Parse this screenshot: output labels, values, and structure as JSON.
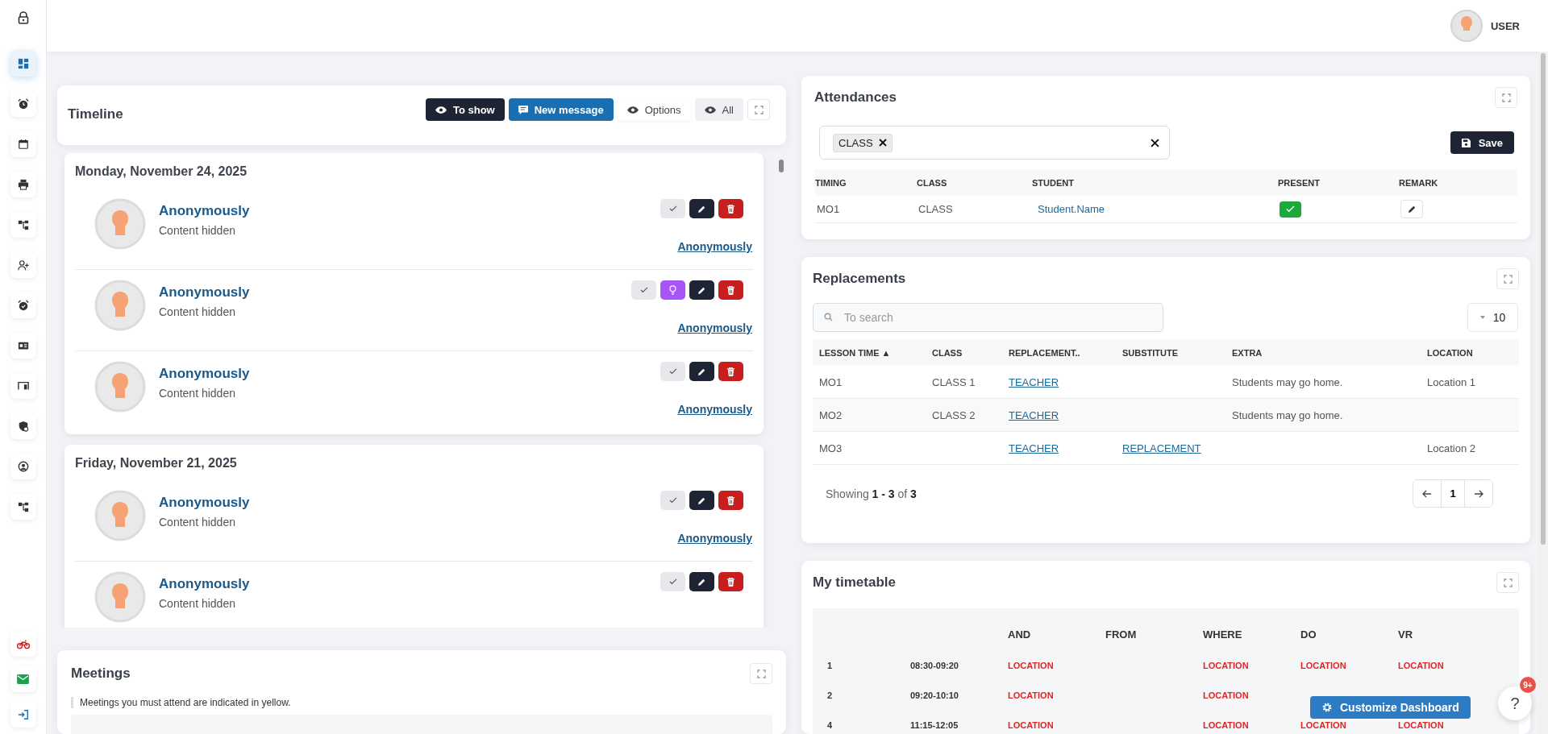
{
  "sidebar": {
    "items": [
      {
        "kind": "dashboard",
        "selected": true
      },
      {
        "kind": "alarm",
        "selected": false
      },
      {
        "kind": "calendar",
        "selected": false
      },
      {
        "kind": "printer",
        "selected": false
      },
      {
        "kind": "hierarchy",
        "selected": false
      },
      {
        "kind": "user-add",
        "selected": false
      },
      {
        "kind": "alarm-check",
        "selected": false
      },
      {
        "kind": "id-card",
        "selected": false
      },
      {
        "kind": "window",
        "selected": false
      },
      {
        "kind": "shield-user",
        "selected": false
      },
      {
        "kind": "user-circle",
        "selected": false
      },
      {
        "kind": "hierarchy",
        "selected": false
      }
    ],
    "bottom_items": [
      {
        "kind": "bike",
        "selected": false
      },
      {
        "kind": "mail",
        "selected": false
      },
      {
        "kind": "logout",
        "selected": false
      }
    ]
  },
  "user": {
    "name": "USER"
  },
  "timeline": {
    "title": "Timeline",
    "buttons": [
      {
        "label": "To show",
        "kind": "dark"
      },
      {
        "label": "New message",
        "kind": "primary"
      },
      {
        "label": "Options",
        "kind": "light"
      },
      {
        "label": "All",
        "kind": "grey"
      }
    ],
    "days": [
      {
        "date": "Monday, November 24, 2025",
        "items": [
          {
            "author": "Anonymously",
            "content": "Content hidden",
            "link": "Anonymously",
            "bulb": false
          },
          {
            "author": "Anonymously",
            "content": "Content hidden",
            "link": "Anonymously",
            "bulb": true
          },
          {
            "author": "Anonymously",
            "content": "Content hidden",
            "link": "Anonymously",
            "bulb": false
          }
        ]
      },
      {
        "date": "Friday, November 21, 2025",
        "items": [
          {
            "author": "Anonymously",
            "content": "Content hidden",
            "link": "Anonymously",
            "bulb": false
          },
          {
            "author": "Anonymously",
            "content": "Content hidden",
            "bulb": false
          }
        ]
      }
    ]
  },
  "meetings": {
    "title": "Meetings",
    "note": "Meetings you must attend are indicated in yellow."
  },
  "attendances": {
    "title": "Attendances",
    "filter_tag": "CLASS",
    "save": "Save",
    "columns": [
      "TIMING",
      "CLASS",
      "STUDENT",
      "PRESENT",
      "REMARK"
    ],
    "rows": [
      {
        "timing": "MO1",
        "class": "CLASS",
        "student": "Student.Name",
        "present": true
      }
    ]
  },
  "replacements": {
    "title": "Replacements",
    "search": {
      "placeholder": "To search"
    },
    "page_size": "10",
    "columns": [
      {
        "label": "LESSON TIME",
        "sort": "▲"
      },
      {
        "label": "CLASS"
      },
      {
        "label": "REPLACEMENT.."
      },
      {
        "label": "SUBSTITUTE"
      },
      {
        "label": "EXTRA"
      },
      {
        "label": "LOCATION"
      }
    ],
    "rows": [
      {
        "time": "MO1",
        "class": "CLASS 1",
        "teacher": "TEACHER",
        "substitute": "",
        "extra": "Students may go home.",
        "location": "Location 1"
      },
      {
        "time": "MO2",
        "class": "CLASS 2",
        "teacher": "TEACHER",
        "substitute": "",
        "extra": "Students may go home.",
        "location": ""
      },
      {
        "time": "MO3",
        "class": "",
        "teacher": "TEACHER",
        "substitute": "REPLACEMENT",
        "extra": "",
        "location": "Location 2"
      }
    ],
    "summary": "Showing **1 - 3** of **3**",
    "page": "1"
  },
  "timetable": {
    "title": "My timetable",
    "columns": [
      "AND",
      "FROM",
      "WHERE",
      "DO",
      "VR"
    ],
    "rows": [
      {
        "period": "1",
        "time": "08:30-09:20",
        "cells": [
          "LOCATION",
          "",
          "LOCATION",
          "LOCATION",
          "LOCATION"
        ]
      },
      {
        "period": "2",
        "time": "09:20-10:10",
        "cells": [
          "LOCATION",
          "",
          "LOCATION",
          "",
          ""
        ]
      },
      {
        "period": "4",
        "time": "11:15-12:05",
        "cells": [
          "LOCATION",
          "",
          "LOCATION",
          "LOCATION",
          "LOCATION"
        ]
      }
    ]
  },
  "customize": {
    "label": "Customize Dashboard"
  },
  "help": {
    "label": "?",
    "badge": "9+"
  }
}
